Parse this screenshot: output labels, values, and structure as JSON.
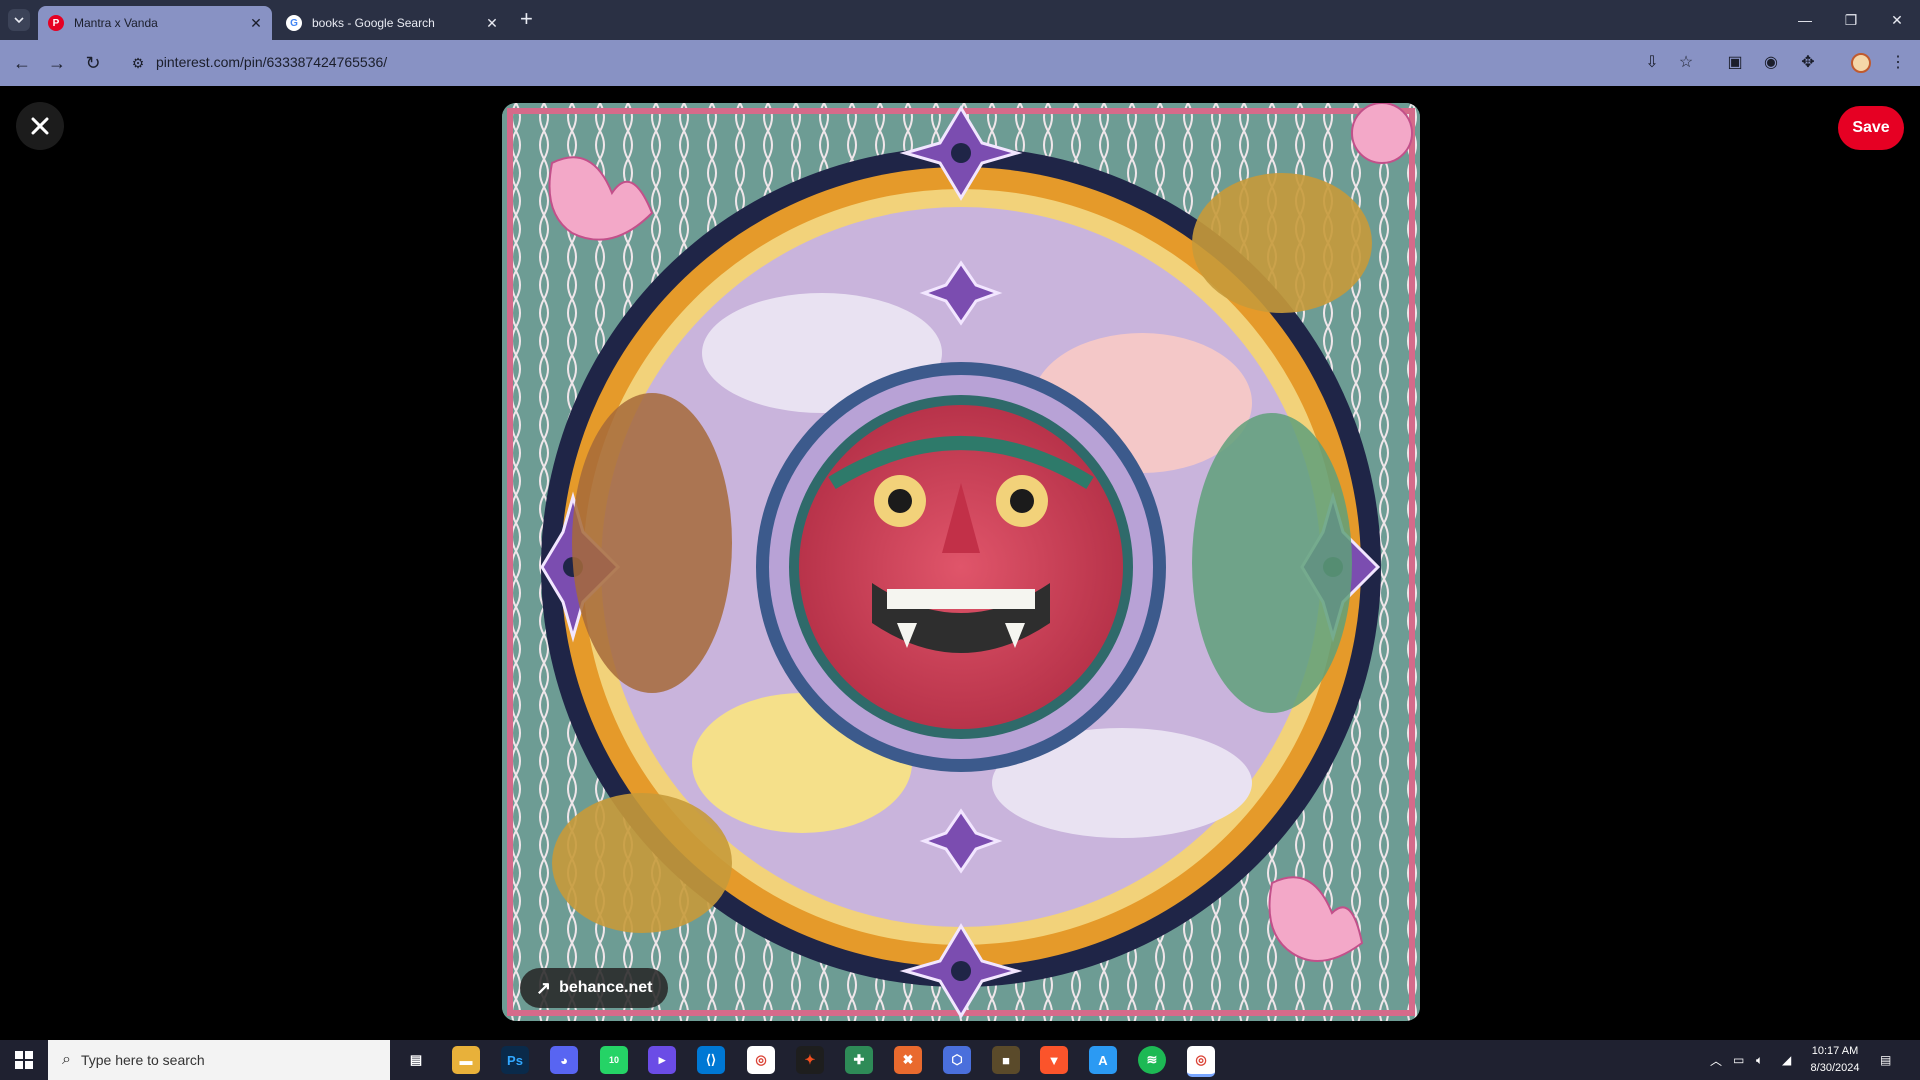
{
  "browser": {
    "tabs": [
      {
        "title": "Mantra x Vanda",
        "favicon": "pinterest-icon",
        "active": true
      },
      {
        "title": "books - Google Search",
        "favicon": "google-icon",
        "active": false
      }
    ],
    "url": "pinterest.com/pin/633387424765536/",
    "accent_color": "#8892c4"
  },
  "pin": {
    "save_label": "Save",
    "source_label": "behance.net",
    "save_color": "#e60023"
  },
  "taskbar": {
    "search_placeholder": "Type here to search",
    "time": "10:17 AM",
    "date": "8/30/2024",
    "whatsapp_badge": "10"
  }
}
